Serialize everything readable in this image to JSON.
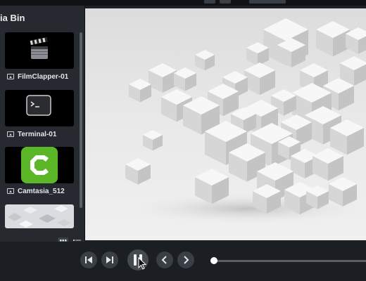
{
  "media_bin": {
    "title": "ia Bin",
    "items": [
      {
        "label": "FilmClapper-01",
        "icon": "film-clapper-icon"
      },
      {
        "label": "Terminal-01",
        "icon": "terminal-icon"
      },
      {
        "label": "Camtasia_512",
        "icon": "camtasia-logo-icon"
      },
      {
        "label": "",
        "icon": "cubes-thumbnail"
      }
    ],
    "view_buttons": [
      "grid-view-icon",
      "list-view-icon"
    ]
  },
  "canvas": {
    "content": "3D white cubes background"
  },
  "playback": {
    "buttons": [
      "step-back-icon",
      "step-forward-icon",
      "pause-icon",
      "previous-icon",
      "next-icon"
    ],
    "progress": 0.02
  },
  "colors": {
    "panel": "#262a30",
    "background": "#1d2127",
    "accent": "#5bb728"
  }
}
